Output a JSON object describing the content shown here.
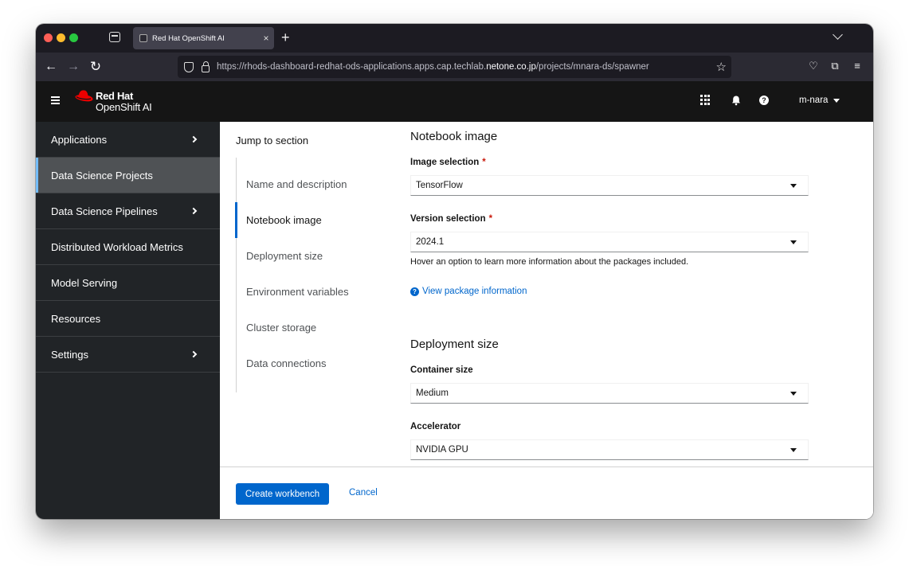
{
  "browser": {
    "tab_title": "Red Hat OpenShift AI",
    "tab_close": "×",
    "new_tab": "+",
    "url_prefix": "https://rhods-dashboard-redhat-ods-applications.apps.cap.techlab.",
    "url_domain": "netone.co.jp",
    "url_path": "/projects/mnara-ds/spawner",
    "icons": [
      "back-arrow-icon",
      "forward-arrow-icon",
      "reload-icon",
      "shield-icon",
      "lock-icon",
      "bookmark-star-icon",
      "pocket-icon",
      "extensions-icon",
      "menu-icon"
    ]
  },
  "masthead": {
    "brand_line1": "Red Hat",
    "brand_line2": "OpenShift AI",
    "help_glyph": "?",
    "user": "m-nara",
    "brand_color": "#ee0000"
  },
  "sidebar": {
    "items": [
      {
        "label": "Applications"
      },
      {
        "label": "Data Science Projects"
      },
      {
        "label": "Data Science Pipelines"
      },
      {
        "label": "Distributed Workload Metrics"
      },
      {
        "label": "Model Serving"
      },
      {
        "label": "Resources"
      },
      {
        "label": "Settings"
      }
    ],
    "active": "Data Science Projects"
  },
  "jump": {
    "title": "Jump to section",
    "items": [
      {
        "label": "Name and description"
      },
      {
        "label": "Notebook image"
      },
      {
        "label": "Deployment size"
      },
      {
        "label": "Environment variables"
      },
      {
        "label": "Cluster storage"
      },
      {
        "label": "Data connections"
      }
    ],
    "active": "Notebook image"
  },
  "form": {
    "notebook_image": {
      "heading": "Notebook image",
      "image_label": "Image selection",
      "image_value": "TensorFlow",
      "version_label": "Version selection",
      "version_value": "2024.1",
      "helper": "Hover an option to learn more information about the packages included.",
      "link": "View package information"
    },
    "deployment_size": {
      "heading": "Deployment size",
      "container_label": "Container size",
      "container_value": "Medium",
      "accelerator_label": "Accelerator",
      "accelerator_value": "NVIDIA GPU"
    },
    "required_mark": "*"
  },
  "footer": {
    "create_label": "Create workbench",
    "cancel_label": "Cancel"
  },
  "colors": {
    "accent": "#0066cc",
    "sidebar_bg": "#212427",
    "masthead_bg": "#151515",
    "required": "#c9190b"
  }
}
